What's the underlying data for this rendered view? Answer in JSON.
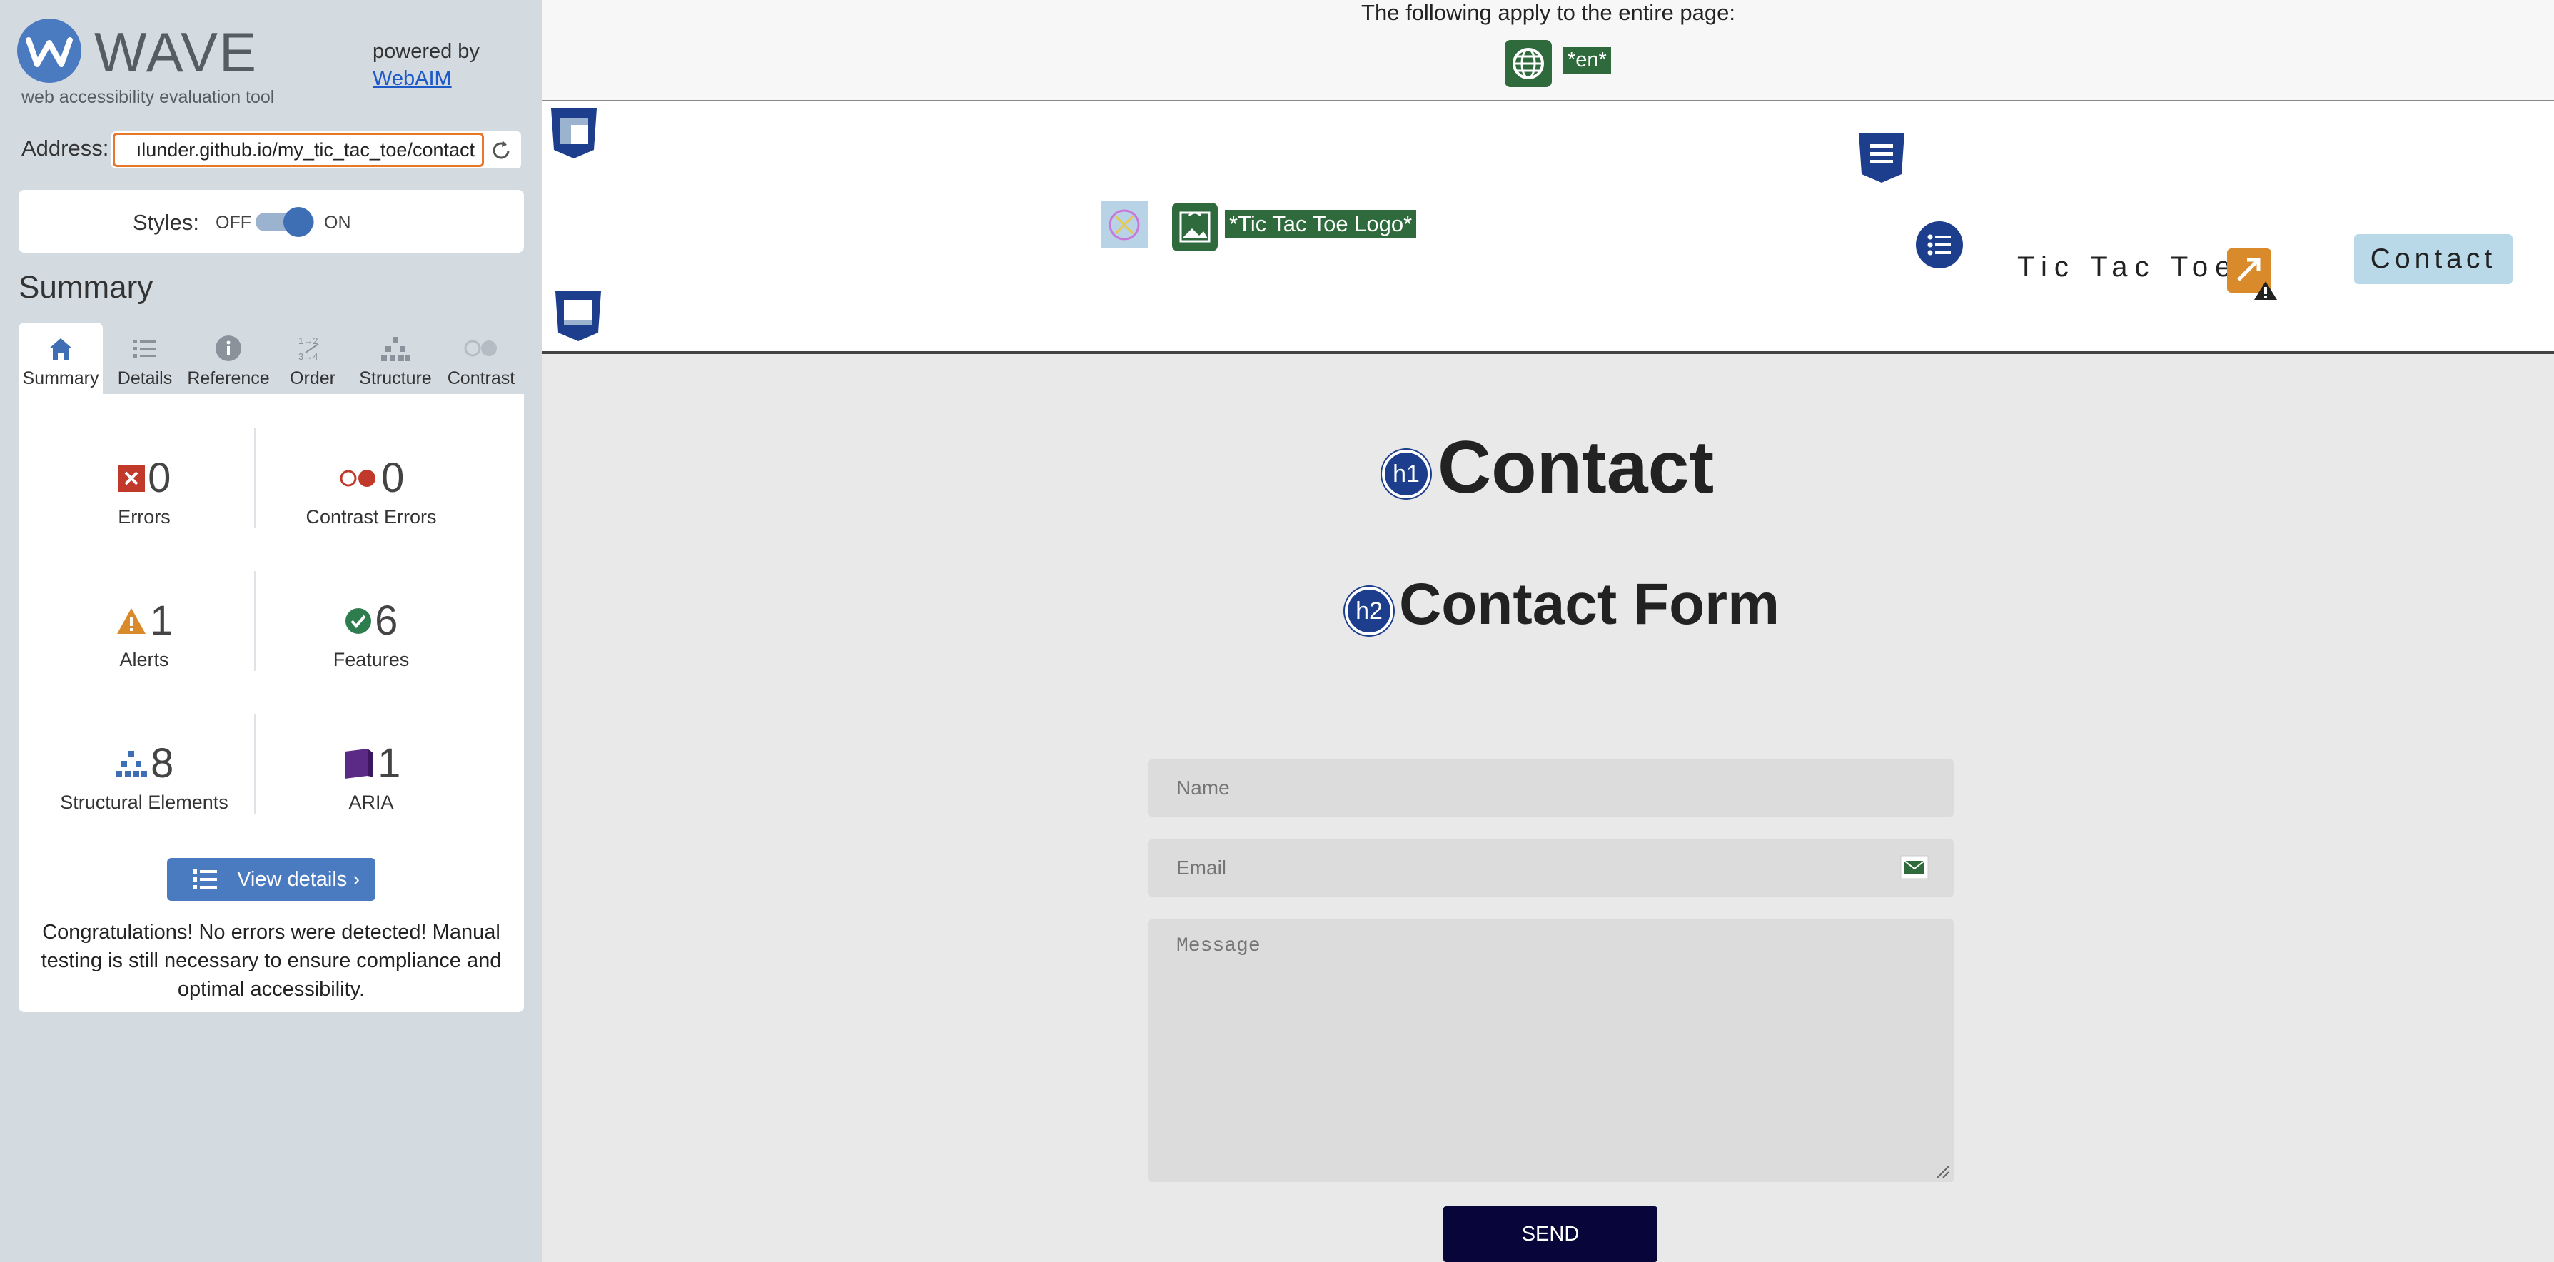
{
  "sidebar": {
    "logo_text": "WAVE",
    "tagline": "web accessibility evaluation tool",
    "powered_by": "powered by",
    "webaim_link": "WebAIM",
    "address_label": "Address:",
    "address_value": "ılunder.github.io/my_tic_tac_toe/contact",
    "styles_label": "Styles:",
    "styles_off": "OFF",
    "styles_on": "ON",
    "summary_heading": "Summary",
    "tabs": [
      {
        "label": "Summary",
        "icon": "home-icon"
      },
      {
        "label": "Details",
        "icon": "list-icon"
      },
      {
        "label": "Reference",
        "icon": "info-icon"
      },
      {
        "label": "Order",
        "icon": "order-icon"
      },
      {
        "label": "Structure",
        "icon": "structure-icon"
      },
      {
        "label": "Contrast",
        "icon": "contrast-icon"
      }
    ],
    "stats": {
      "errors": {
        "value": "0",
        "label": "Errors"
      },
      "contrast_errors": {
        "value": "0",
        "label": "Contrast Errors"
      },
      "alerts": {
        "value": "1",
        "label": "Alerts"
      },
      "features": {
        "value": "6",
        "label": "Features"
      },
      "structural": {
        "value": "8",
        "label": "Structural Elements"
      },
      "aria": {
        "value": "1",
        "label": "ARIA"
      }
    },
    "view_details": "View details ›",
    "congrats": "Congratulations! No errors were detected! Manual testing is still necessary to ensure compliance and optimal accessibility."
  },
  "page": {
    "apply_text": "The following apply to the entire page:",
    "lang_tag": "*en*",
    "logo_alt_tag": "*Tic Tac Toe Logo*",
    "brand": "Tic Tac Toe",
    "nav_contact": "Contact",
    "h1_badge": "h1",
    "h1": "Contact",
    "h2_badge": "h2",
    "h2": "Contact Form",
    "name_placeholder": "Name",
    "email_placeholder": "Email",
    "message_placeholder": "Message",
    "send": "SEND"
  },
  "colors": {
    "wave_blue": "#4a7ac0",
    "feature_green": "#2e6a3c",
    "structure_navy": "#1d3e8c",
    "alert_orange": "#d98a2b",
    "error_red": "#c0392b"
  }
}
